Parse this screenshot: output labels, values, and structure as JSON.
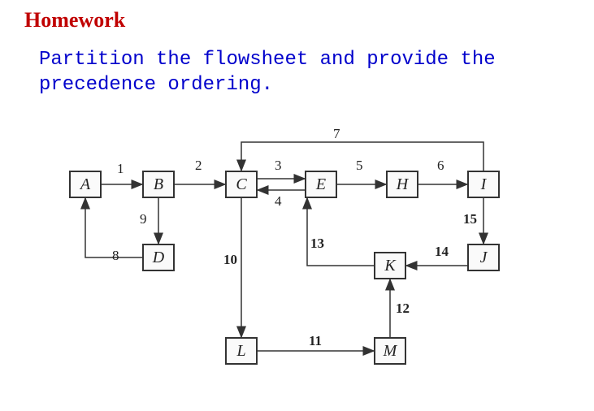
{
  "header": "Homework",
  "prompt_line1": "Partition the flowsheet and provide the",
  "prompt_line2": "precedence ordering.",
  "nodes": {
    "A": "A",
    "B": "B",
    "C": "C",
    "D": "D",
    "E": "E",
    "H": "H",
    "I": "I",
    "J": "J",
    "K": "K",
    "L": "L",
    "M": "M"
  },
  "edges": {
    "e1": "1",
    "e2": "2",
    "e3": "3",
    "e4": "4",
    "e5": "5",
    "e6": "6",
    "e7": "7",
    "e8": "8",
    "e9": "9",
    "e10": "10",
    "e11": "11",
    "e12": "12",
    "e13": "13",
    "e14": "14",
    "e15": "15"
  },
  "chart_data": {
    "type": "diagram",
    "title": "Flowsheet directed graph",
    "nodes": [
      "A",
      "B",
      "C",
      "D",
      "E",
      "H",
      "I",
      "J",
      "K",
      "L",
      "M"
    ],
    "edges": [
      {
        "id": 1,
        "from": "A",
        "to": "B"
      },
      {
        "id": 2,
        "from": "B",
        "to": "C"
      },
      {
        "id": 3,
        "from": "C",
        "to": "E"
      },
      {
        "id": 4,
        "from": "E",
        "to": "C"
      },
      {
        "id": 5,
        "from": "E",
        "to": "H"
      },
      {
        "id": 6,
        "from": "H",
        "to": "I"
      },
      {
        "id": 7,
        "from": "I",
        "to": "C"
      },
      {
        "id": 8,
        "from": "D",
        "to": "A"
      },
      {
        "id": 9,
        "from": "B",
        "to": "D"
      },
      {
        "id": 10,
        "from": "C",
        "to": "L"
      },
      {
        "id": 11,
        "from": "L",
        "to": "M"
      },
      {
        "id": 12,
        "from": "M",
        "to": "K"
      },
      {
        "id": 13,
        "from": "K",
        "to": "E"
      },
      {
        "id": 14,
        "from": "J",
        "to": "K"
      },
      {
        "id": 15,
        "from": "I",
        "to": "J"
      }
    ]
  }
}
